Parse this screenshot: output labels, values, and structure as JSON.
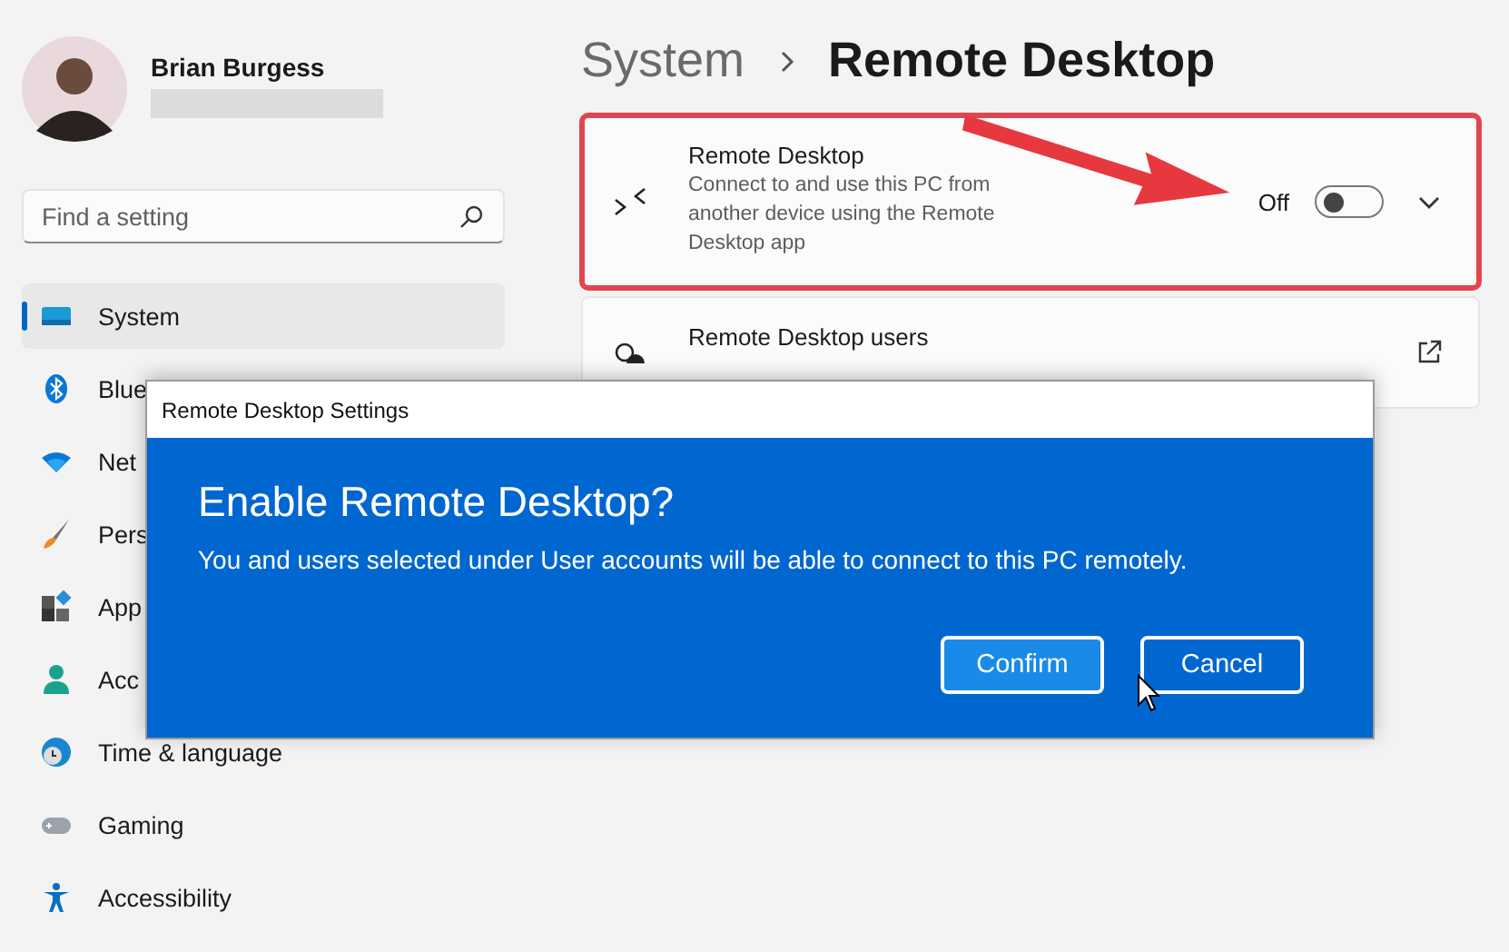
{
  "user": {
    "name": "Brian Burgess"
  },
  "search": {
    "placeholder": "Find a setting"
  },
  "nav": [
    {
      "label": "System",
      "selected": true
    },
    {
      "label": "Blue",
      "selected": false
    },
    {
      "label": "Net",
      "selected": false
    },
    {
      "label": "Pers",
      "selected": false
    },
    {
      "label": "App",
      "selected": false
    },
    {
      "label": "Acc",
      "selected": false
    },
    {
      "label": "Time & language",
      "selected": false
    },
    {
      "label": "Gaming",
      "selected": false
    },
    {
      "label": "Accessibility",
      "selected": false
    }
  ],
  "breadcrumb": [
    "System",
    "Remote Desktop"
  ],
  "settings": [
    {
      "kind": "toggle",
      "title": "Remote Desktop",
      "description": "Connect to and use this PC from another device using the Remote Desktop app",
      "state_label": "Off",
      "on": false,
      "highlighted": true
    },
    {
      "kind": "link",
      "title": "Remote Desktop users",
      "highlighted": false
    }
  ],
  "dialog": {
    "title": "Remote Desktop Settings",
    "heading": "Enable Remote Desktop?",
    "message": "You and users selected under User accounts will be able to connect to this PC remotely.",
    "buttons": [
      {
        "label": "Confirm",
        "focused": true
      },
      {
        "label": "Cancel",
        "focused": false
      }
    ]
  }
}
